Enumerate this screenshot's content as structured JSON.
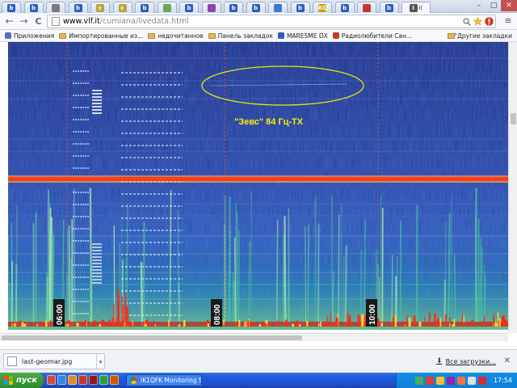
{
  "browser": {
    "tabs": [
      {
        "icon": "b",
        "color": "#2d5dbd"
      },
      {
        "icon": "b",
        "color": "#2d5dbd"
      },
      {
        "icon": "link",
        "color": "#7a7a7a"
      },
      {
        "icon": "b",
        "color": "#2d5dbd"
      },
      {
        "icon": "c",
        "color": "#b8a43a"
      },
      {
        "icon": "c",
        "color": "#b8a43a"
      },
      {
        "icon": "b",
        "color": "#2d5dbd"
      },
      {
        "icon": "puzzle",
        "color": "#6aa84f"
      },
      {
        "icon": "b",
        "color": "#2d5dbd"
      },
      {
        "icon": "cube",
        "color": "#8e44ad"
      },
      {
        "icon": "b",
        "color": "#2d5dbd"
      },
      {
        "icon": "b",
        "color": "#2d5dbd"
      },
      {
        "icon": "flower",
        "color": "#3c78d8"
      },
      {
        "icon": "b",
        "color": "#2d5dbd"
      },
      {
        "icon": "KQ",
        "color": "#c9a400"
      },
      {
        "icon": "b",
        "color": "#2d5dbd"
      },
      {
        "icon": "check",
        "color": "#c0392b"
      },
      {
        "icon": "b",
        "color": "#2d5dbd"
      },
      {
        "icon": "I",
        "color": "#555555",
        "label": "I(",
        "active": true
      }
    ],
    "window_controls": {
      "minimize": "–",
      "maximize": "□",
      "close": "✕"
    },
    "nav": {
      "back": "←",
      "forward": "→",
      "reload": "C"
    },
    "url": {
      "host": "www.vlf.it",
      "path": "/cumiana/livedata.html"
    },
    "omnibox_icons": {
      "search": "search-icon",
      "star": "star-icon",
      "extension": "adblock-icon"
    },
    "menu": "≡"
  },
  "bookmarks": {
    "items": [
      {
        "label": "Приложения",
        "kind": "apps",
        "color": "#5c6bc0"
      },
      {
        "label": "Импортированные из...",
        "kind": "folder"
      },
      {
        "label": "недочитанное",
        "kind": "folder"
      },
      {
        "label": "Панель закладок",
        "kind": "folder"
      },
      {
        "label": "MARESME DX",
        "kind": "site",
        "color": "#2d5dbd"
      },
      {
        "label": "Радиолюбители Сан...",
        "kind": "site",
        "color": "#c0392b"
      }
    ],
    "more": "»",
    "other": "Другие закладки"
  },
  "spectrogram": {
    "annotation": "\"Зевс\" 84 Гц-ТХ",
    "time_labels": [
      "06:00",
      "08:00",
      "10:00"
    ],
    "colors": {
      "background": "#1a2a8a",
      "hum_line": "#ff2a1a",
      "annotation": "#ffee00"
    }
  },
  "downloads": {
    "file": "last-geomar.jpg",
    "all": "Все загрузки...",
    "close": "✕"
  },
  "taskbar": {
    "start": "пуск",
    "task": "IK1QFK Monitoring St...",
    "lang": "EN",
    "clock": "17:54"
  }
}
